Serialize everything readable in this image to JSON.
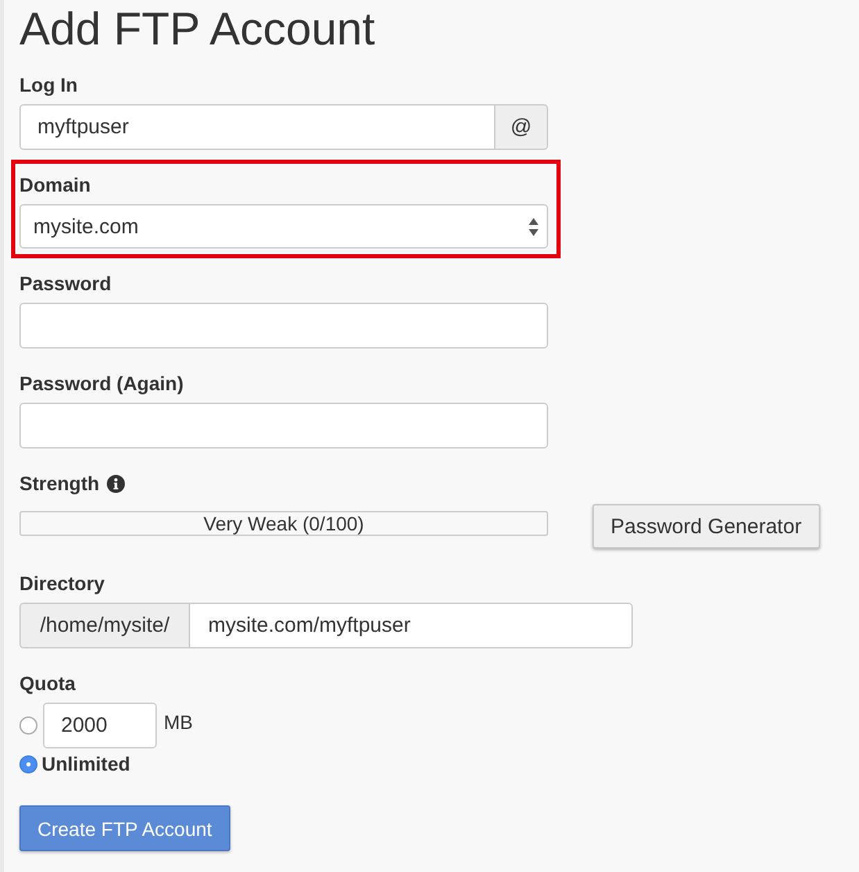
{
  "title": "Add FTP Account",
  "login": {
    "label": "Log In",
    "value": "myftpuser",
    "addon": "@"
  },
  "domain": {
    "label": "Domain",
    "value": "mysite.com",
    "highlighted": true
  },
  "password": {
    "label": "Password"
  },
  "password_again": {
    "label": "Password (Again)"
  },
  "strength": {
    "label": "Strength",
    "meter_text": "Very Weak (0/100)",
    "level": 0
  },
  "password_generator": {
    "label": "Password Generator"
  },
  "directory": {
    "label": "Directory",
    "prefix": "/home/mysite/",
    "value": "mysite.com/myftpuser"
  },
  "quota": {
    "label": "Quota",
    "options": [
      {
        "kind": "amount",
        "selected": false,
        "value": "2000",
        "unit": "MB"
      },
      {
        "kind": "unlimited",
        "selected": true,
        "label": "Unlimited"
      }
    ]
  },
  "submit": {
    "label": "Create FTP Account"
  }
}
